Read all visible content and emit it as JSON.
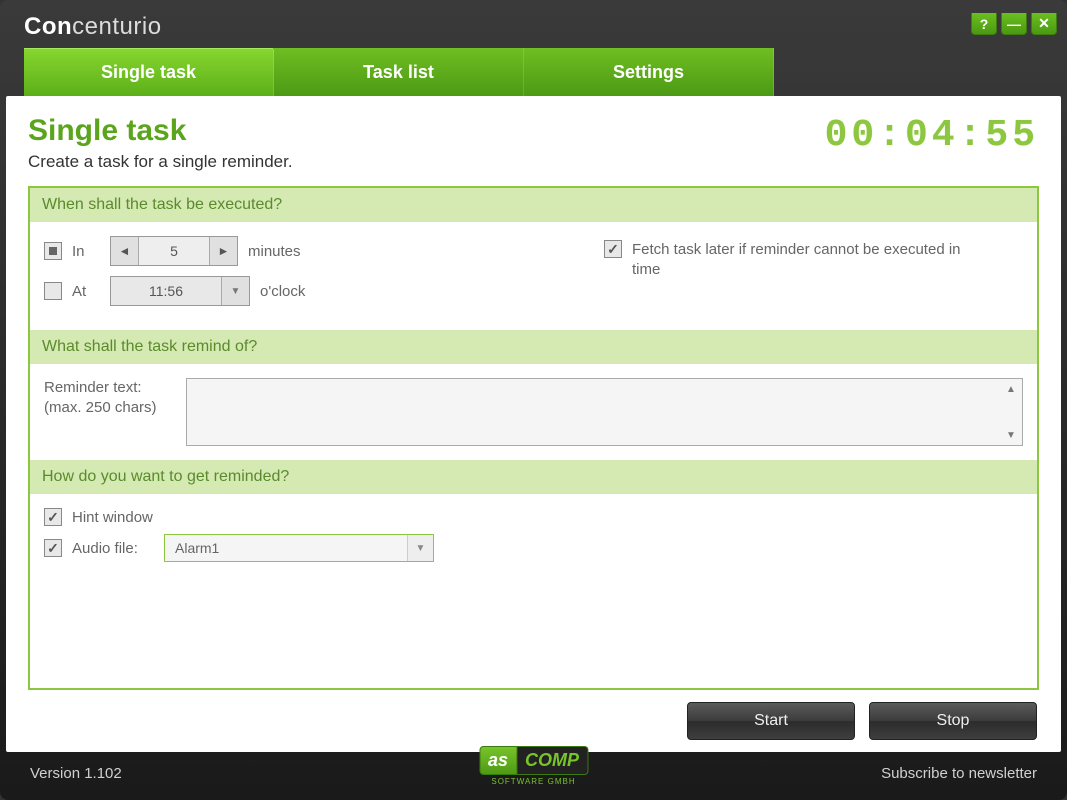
{
  "app": {
    "title_bold": "Con",
    "title_rest": "centurio"
  },
  "tabs": {
    "single": "Single task",
    "list": "Task list",
    "settings": "Settings"
  },
  "page": {
    "title": "Single task",
    "subtitle": "Create a task for a single reminder."
  },
  "timer": "00:04:55",
  "sections": {
    "when": "When shall the task be executed?",
    "what": "What shall the task remind of?",
    "how": "How do you want to get reminded?"
  },
  "when": {
    "in_label": "In",
    "in_value": "5",
    "in_unit": "minutes",
    "at_label": "At",
    "at_value": "11:56",
    "at_unit": "o'clock",
    "fetch_label": "Fetch task later if reminder cannot be executed in time"
  },
  "what": {
    "label": "Reminder text:",
    "hint": "(max. 250 chars)",
    "value": ""
  },
  "how": {
    "hint_label": "Hint window",
    "audio_label": "Audio file:",
    "audio_value": "Alarm1"
  },
  "buttons": {
    "start": "Start",
    "stop": "Stop"
  },
  "footer": {
    "version": "Version 1.102",
    "logo_as": "as",
    "logo_comp": "COMP",
    "logo_sub": "SOFTWARE GMBH",
    "subscribe": "Subscribe to newsletter"
  }
}
